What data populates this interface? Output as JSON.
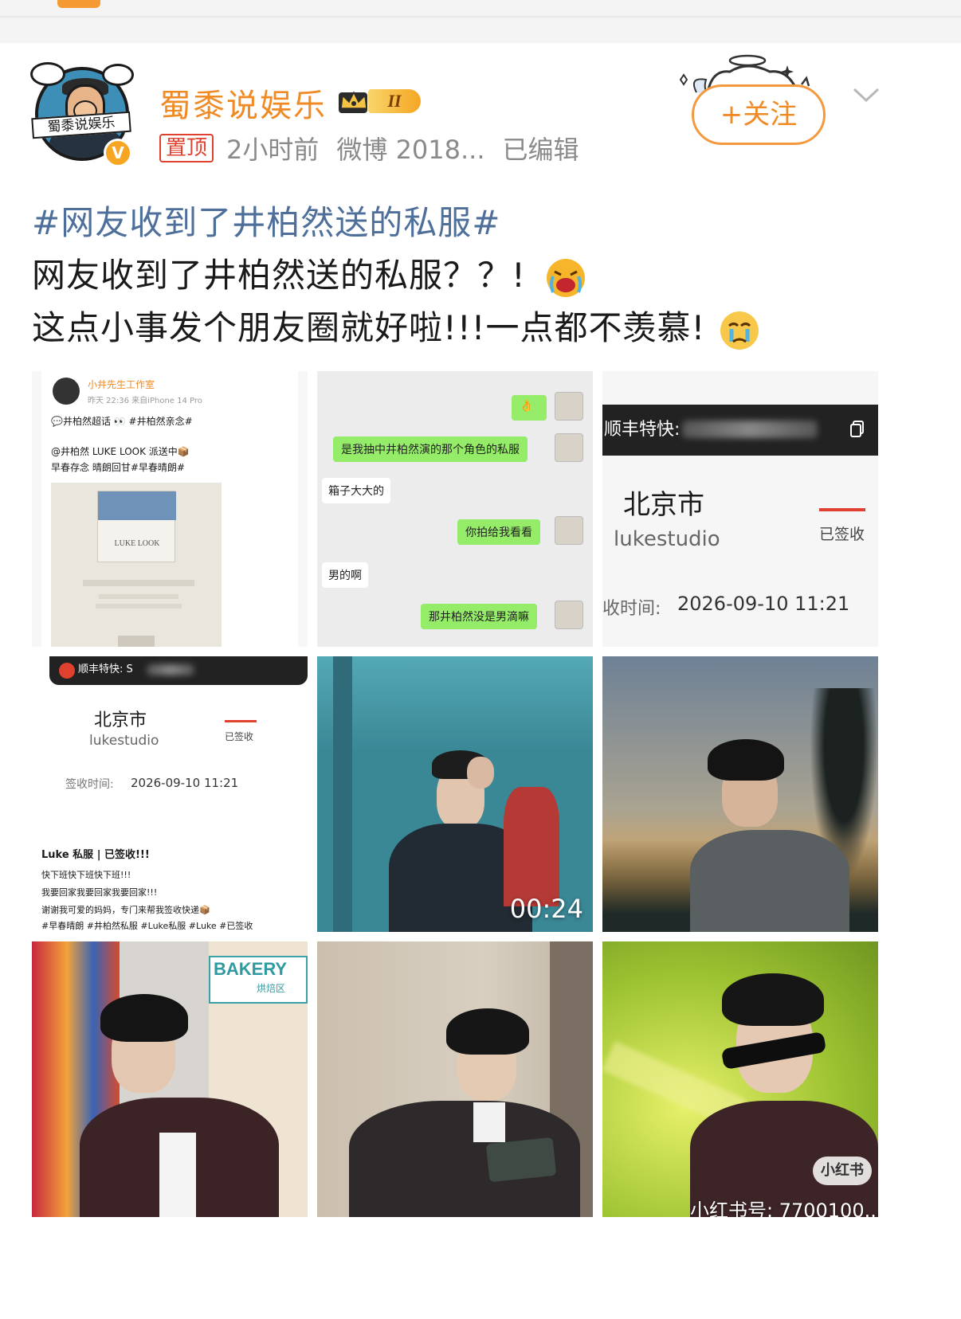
{
  "post": {
    "author": "蜀黍说娱乐",
    "level_badge": "II",
    "avatar_banner": "蜀黍说娱乐",
    "pinned_label": "置顶",
    "time": "2小时前",
    "source": "微博 2018...",
    "edited": "已编辑",
    "follow_label": "+关注",
    "hashtag": "#网友收到了井柏然送的私服#",
    "text_line1": "网友收到了井柏然送的私服？？!",
    "text_line2": "这点小事发个朋友圈就好啦!!!一点都不羡慕!"
  },
  "images": {
    "img1": {
      "account": "小井先生工作室",
      "meta": "昨天 22:36  来自iPhone 14 Pro",
      "line1": "💬井柏然超话 👀 #井柏然亲念#",
      "line2": "@井柏然 LUKE LOOK 派送中📦",
      "line3": "早春存念 晴朗回甘#早春晴朗#",
      "bag_label": "LUKE LOOK"
    },
    "img2": {
      "messages": [
        {
          "side": "right",
          "text": "👌"
        },
        {
          "side": "right",
          "text": "是我抽中井柏然演的那个角色的私服"
        },
        {
          "side": "left",
          "text": "箱子大大的"
        },
        {
          "side": "right",
          "text": "你拍给我看看"
        },
        {
          "side": "left",
          "text": "男的啊"
        },
        {
          "side": "right",
          "text": "那井柏然没是男滴嘛"
        }
      ]
    },
    "img3": {
      "carrier": "顺丰特快:",
      "city": "北京市",
      "studio": "lukestudio",
      "status": "已签收",
      "time_label": "收时间:",
      "time": "2026-09-10 11:21"
    },
    "img4": {
      "carrier": "顺丰特快: S",
      "city": "北京市",
      "studio": "lukestudio",
      "status": "已签收",
      "time_label": "签收时间:",
      "time": "2026-09-10 11:21",
      "caption_title": "Luke 私服 | 已签收!!!",
      "caption1": "快下班快下班快下班!!!",
      "caption2": "我要回家我要回家我要回家!!!",
      "caption3": "谢谢我可爱的妈妈，专门来帮我签收快递📦",
      "caption4": "#早春晴朗 #井柏然私服 #Luke私服 #Luke #已签收"
    },
    "img5": {
      "duration": "00:24"
    },
    "img7": {
      "shop_sign": "BAKERY",
      "shop_sub": "烘焙区"
    },
    "img9": {
      "app_badge": "小红书",
      "watermark": "小红书号: 7700100..."
    }
  },
  "colors": {
    "accent_orange": "#f08a24",
    "hashtag_blue": "#4f6f9b",
    "pin_red": "#e0412f",
    "chat_green": "#95ec69"
  }
}
